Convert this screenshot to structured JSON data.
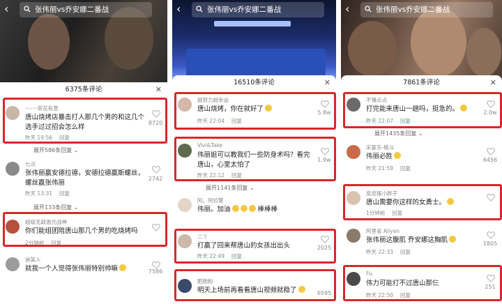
{
  "search_query": "张伟丽vs乔安娜二番战",
  "panels": [
    {
      "comment_count": "6375条评论",
      "comments": [
        {
          "user": "·-·-·-·菲花有意",
          "text": "唐山烧烤店暴击打人那几个男的和这几个选手过过招会怎么样",
          "time": "昨天 19:56",
          "reply": "回复",
          "likes": "8720",
          "highlighted": true
        },
        {
          "user": "七点",
          "text": "张伟丽赢安德拉德，安德拉德赢斯螺丝，螺丝赢张伟丽",
          "time": "昨天 13:31",
          "reply": "回复",
          "likes": "2742",
          "highlighted": false
        },
        {
          "user": "超级无敌激光战神",
          "text": "你们能组团陪唐山那几个男的吃烧烤吗",
          "time": "2分钟前",
          "reply": "回复",
          "likes": "",
          "highlighted": true
        },
        {
          "user": "迪某人",
          "text": "就我一个人觉得张伟丽特别帅嘛",
          "time": "",
          "reply": "",
          "likes": "7586",
          "highlighted": false
        }
      ],
      "expands": [
        "展开586条回复",
        "展开133条回复"
      ]
    },
    {
      "comment_count": "16510条评论",
      "comments": [
        {
          "user": "越努力越幸运",
          "text": "唐山烧烤，你在就好了",
          "time": "昨天 22:04",
          "reply": "回复",
          "likes": "5.8w",
          "highlighted": true
        },
        {
          "user": "Vivi&Take",
          "text": "伟丽姐可以教我们一些防身术吗？看完唐山，心里太怕了",
          "time": "昨天 22:12",
          "reply": "回复",
          "likes": "1.9w",
          "highlighted": true
        },
        {
          "user": "阿。阿拉警",
          "text": "伟丽。加油",
          "time": "",
          "reply": "",
          "likes": "",
          "highlighted": false
        },
        {
          "user": "二丫",
          "text": "打赢了回来帮唐山的女孩出出头",
          "time": "昨天 22:49",
          "reply": "回复",
          "likes": "2025",
          "highlighted": true
        },
        {
          "user": "肥肠粉",
          "text": "明天上场前再看看唐山视频就稳了",
          "time": "",
          "reply": "",
          "likes": "6595",
          "highlighted": true
        }
      ],
      "expands": [
        "展开1141条回复"
      ],
      "extra_text": "棒棒棒"
    },
    {
      "comment_count": "7861条评论",
      "comments": [
        {
          "user": "不懂点点",
          "text": "打完能来唐山一趟吗，挺急的。",
          "time": "昨天 22:07",
          "reply": "回复",
          "likes": "2.0w",
          "highlighted": true
        },
        {
          "user": "宋宴东-桃斗",
          "text": "伟丽必胜",
          "time": "昨天 21:59",
          "reply": "回复",
          "likes": "6456",
          "highlighted": false
        },
        {
          "user": "皮皮猴小胖子",
          "text": "唐山需要你这样的女勇士。",
          "time": "1分钟前",
          "reply": "回复",
          "likes": "",
          "highlighted": true
        },
        {
          "user": "阿里省 Aliyan",
          "text": "张伟丽这腹肌 乔安娜这胸肌",
          "time": "昨天 22:33",
          "reply": "回复",
          "likes": "1805",
          "highlighted": false
        },
        {
          "user": "Fu.",
          "text": "伟力可能打不过唐山那仨",
          "time": "昨天 22:50",
          "reply": "回复",
          "likes": "251",
          "highlighted": true
        }
      ],
      "expands": [
        "展开1435条回复"
      ]
    }
  ],
  "colors": {
    "highlight": "#d8272b",
    "meta": "#888888"
  }
}
